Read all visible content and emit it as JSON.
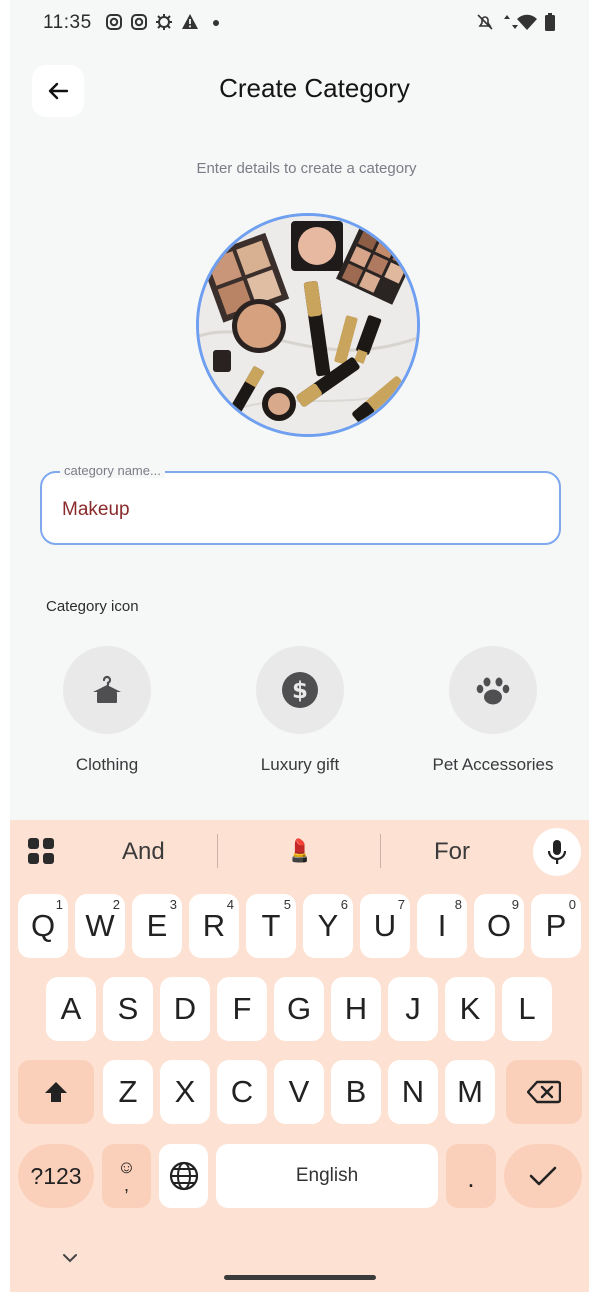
{
  "status_bar": {
    "time": "11:35",
    "icons": [
      "instagram-icon",
      "instagram-icon",
      "settings-sun-icon",
      "warning-icon",
      "dot",
      "silent-icon",
      "data-arrows-icon",
      "wifi-icon",
      "battery-icon"
    ]
  },
  "header": {
    "back_icon": "arrow-left-icon",
    "title": "Create Category",
    "subtitle": "Enter details to create a category"
  },
  "category_image": {
    "description_icon": "makeup-photo"
  },
  "name_field": {
    "label": "category name...",
    "value": "Makeup"
  },
  "category_icon_section": {
    "label": "Category icon",
    "options": [
      {
        "label": "Clothing",
        "icon": "hanger-shirt-icon"
      },
      {
        "label": "Luxury gift",
        "icon": "dollar-coin-icon"
      },
      {
        "label": "Pet Accessories",
        "icon": "paw-icon"
      }
    ]
  },
  "keyboard": {
    "suggestions": [
      "And",
      "💄",
      "For"
    ],
    "row1": [
      {
        "k": "Q",
        "s": "1"
      },
      {
        "k": "W",
        "s": "2"
      },
      {
        "k": "E",
        "s": "3"
      },
      {
        "k": "R",
        "s": "4"
      },
      {
        "k": "T",
        "s": "5"
      },
      {
        "k": "Y",
        "s": "6"
      },
      {
        "k": "U",
        "s": "7"
      },
      {
        "k": "I",
        "s": "8"
      },
      {
        "k": "O",
        "s": "9"
      },
      {
        "k": "P",
        "s": "0"
      }
    ],
    "row2": [
      "A",
      "S",
      "D",
      "F",
      "G",
      "H",
      "J",
      "K",
      "L"
    ],
    "row3": [
      "Z",
      "X",
      "C",
      "V",
      "B",
      "N",
      "M"
    ],
    "symbols_key": "?123",
    "emoji_key": "☺",
    "emoji_sub": ",",
    "space_key": "English",
    "period_key": ".",
    "collapse_icon": "chevron-down-icon"
  },
  "colors": {
    "accent": "#7fa8ef",
    "keyboard_bg": "#fde2d4",
    "key_dark": "#fbd0bb"
  }
}
